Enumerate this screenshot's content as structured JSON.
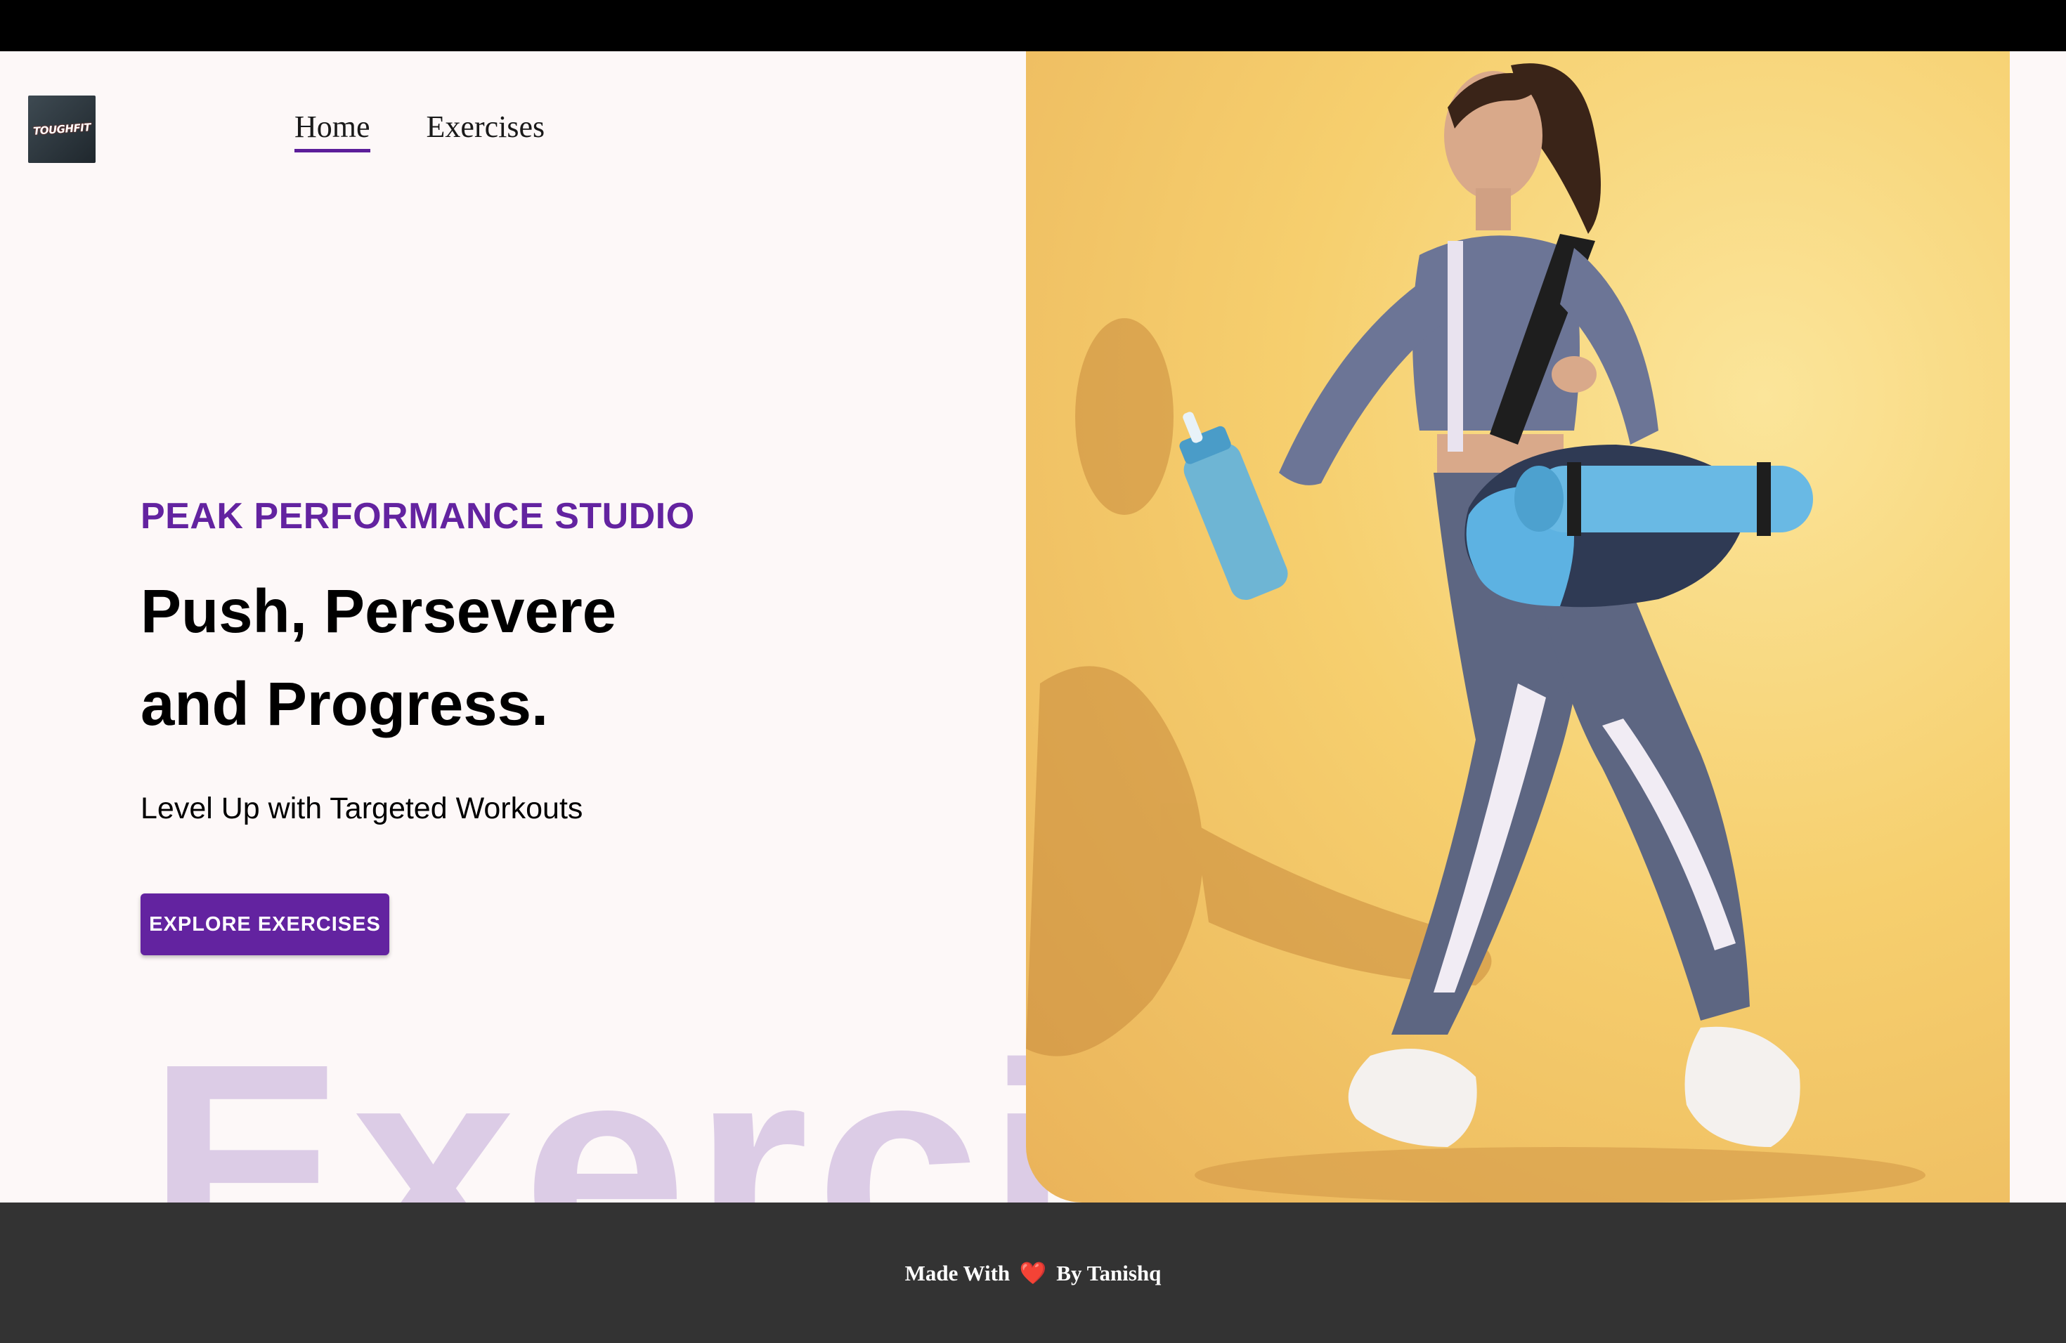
{
  "brand": {
    "logo_text": "TOUGHFIT"
  },
  "nav": {
    "items": [
      {
        "label": "Home",
        "active": true
      },
      {
        "label": "Exercises",
        "active": false
      }
    ]
  },
  "hero": {
    "eyebrow": "PEAK PERFORMANCE STUDIO",
    "headline_line1": "Push, Persevere",
    "headline_line2": "and Progress.",
    "subheading": "Level Up with Targeted Workouts",
    "cta_label": "EXPLORE EXERCISES",
    "watermark": "Exercises"
  },
  "footer": {
    "prefix": "Made With",
    "heart": "❤️",
    "suffix": "By Tanishq"
  },
  "colors": {
    "accent": "#6323a0",
    "page_bg": "#fdf8f8",
    "footer_bg": "#333333",
    "image_bg": "#f6cf6e"
  },
  "icons": {
    "heart": "heart-icon"
  }
}
